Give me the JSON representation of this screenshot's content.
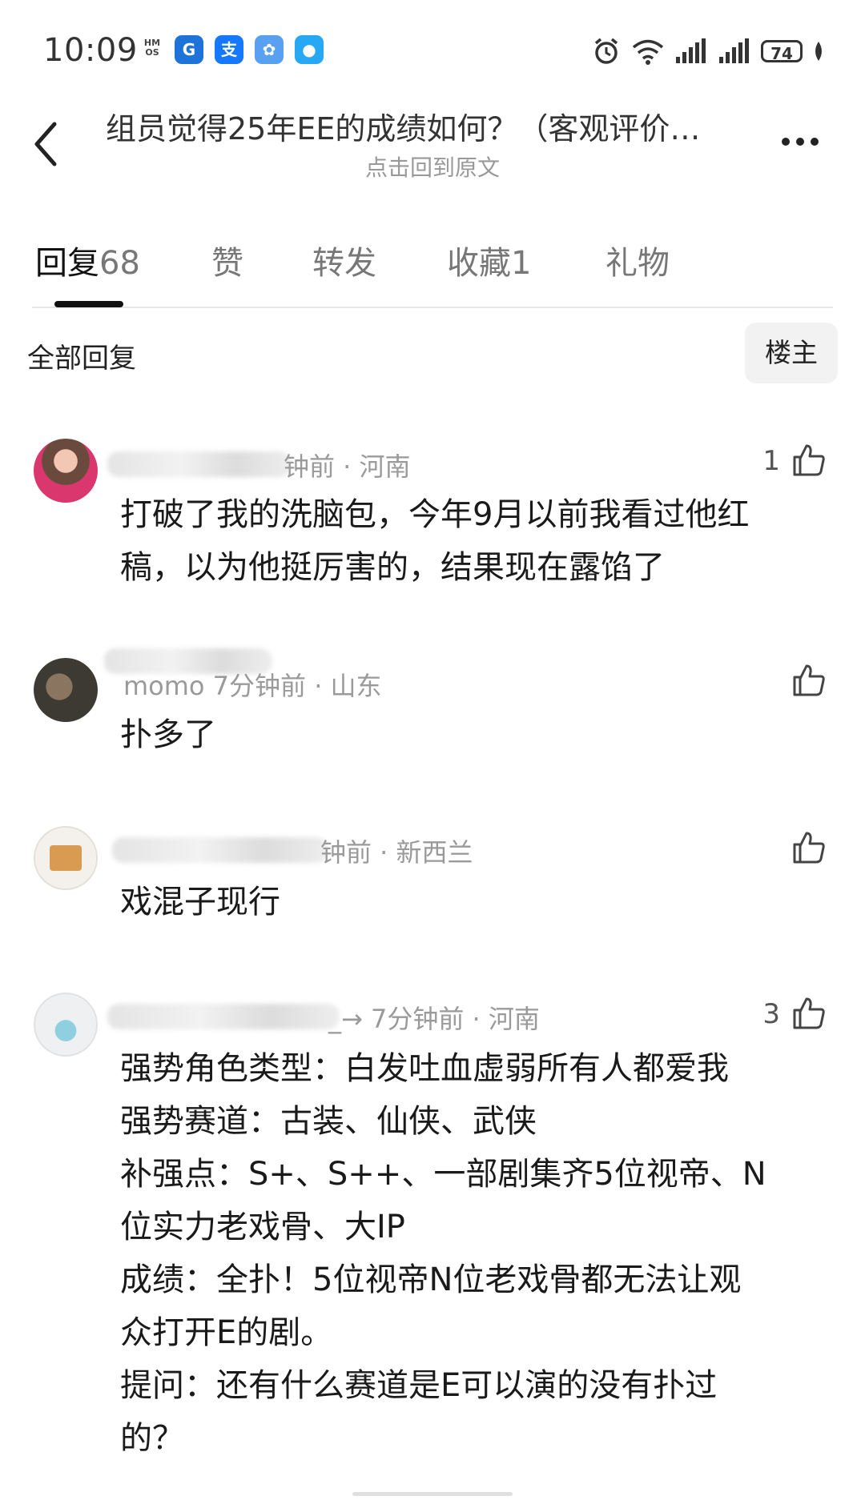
{
  "status_bar": {
    "time": "10:09",
    "hmos": "HM OS",
    "apps": [
      {
        "icon": "gd-app-icon",
        "glyph": "G",
        "color": "#1e73d8"
      },
      {
        "icon": "alipay-icon",
        "glyph": "支",
        "color": "#1677ff"
      },
      {
        "icon": "cloud-app-icon",
        "glyph": "✿",
        "color": "#5aa0f0"
      },
      {
        "icon": "message-app-icon",
        "glyph": "●",
        "color": "#27a8f5"
      }
    ],
    "battery": "74"
  },
  "header": {
    "title": "组员觉得25年EE的成绩如何？（客观评价…",
    "subtitle": "点击回到原文"
  },
  "tabs": [
    {
      "label": "回复",
      "count": "68",
      "active": true
    },
    {
      "label": "赞",
      "count": "",
      "active": false
    },
    {
      "label": "转发",
      "count": "",
      "active": false
    },
    {
      "label": "收藏",
      "count": "1",
      "active": false
    },
    {
      "label": "礼物",
      "count": "",
      "active": false
    }
  ],
  "filter": {
    "all_label": "全部回复",
    "op_label": "楼主"
  },
  "comments": [
    {
      "meta": "钟前 · 河南",
      "likes": "1",
      "lines": [
        "打破了我的洗脑包，今年9月以前我看过他红",
        "稿，以为他挺厉害的，结果现在露馅了"
      ]
    },
    {
      "meta": "momo  7分钟前 · 山东",
      "likes": "",
      "lines": [
        "扑多了"
      ]
    },
    {
      "meta": "钟前 · 新西兰",
      "likes": "",
      "lines": [
        "戏混子现行"
      ]
    },
    {
      "meta": "_→ 7分钟前 · 河南",
      "likes": "3",
      "lines": [
        "强势角色类型：白发吐血虚弱所有人都爱我",
        "强势赛道：古装、仙侠、武侠",
        "补强点：S+、S++、一部剧集齐5位视帝、N",
        "位实力老戏骨、大IP",
        "成绩：全扑！5位视帝N位老戏骨都无法让观",
        "众打开E的剧。",
        "提问：还有什么赛道是E可以演的没有扑过",
        "的？"
      ]
    }
  ]
}
